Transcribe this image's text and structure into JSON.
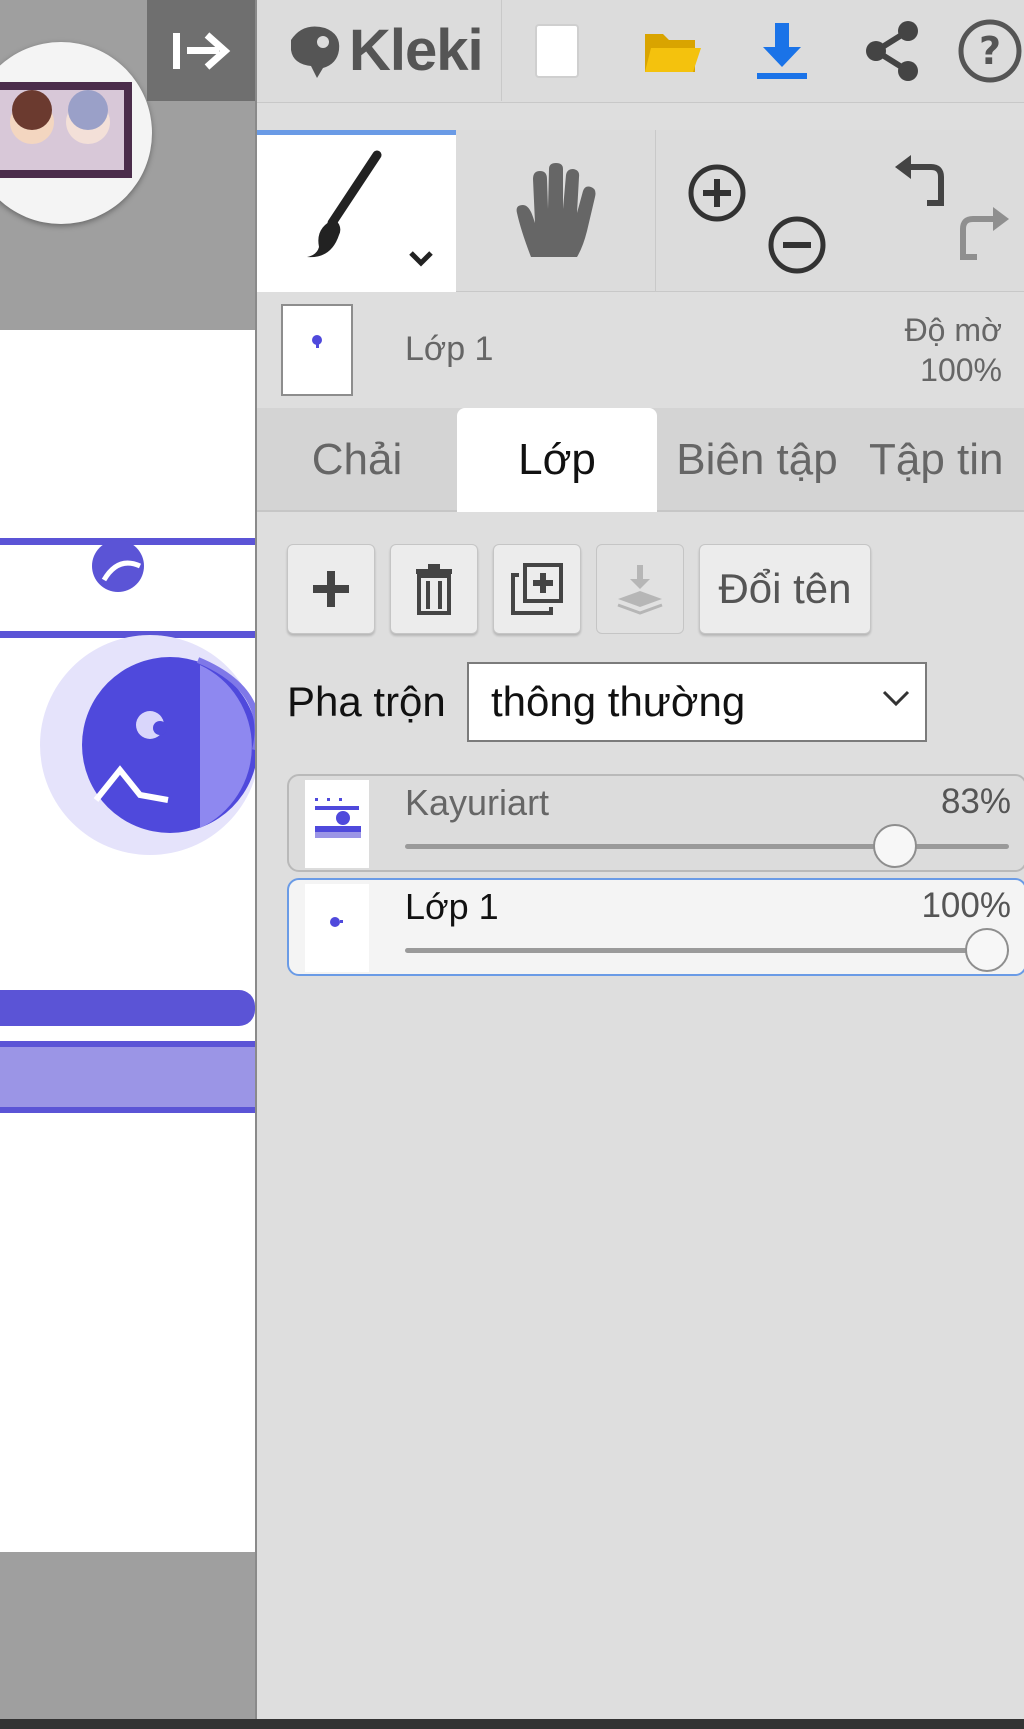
{
  "app": {
    "name": "Kleki"
  },
  "toolbar": {
    "logo_text": "Kleki",
    "buttons": [
      "new-document",
      "open-file",
      "download",
      "share",
      "help"
    ]
  },
  "tools": {
    "active": "brush",
    "zoom": [
      "zoom-in",
      "zoom-out"
    ],
    "history": [
      "undo",
      "redo"
    ]
  },
  "current_layer": {
    "name": "Lớp 1",
    "opacity_label": "Độ mờ",
    "opacity_value": "100%"
  },
  "tabs": [
    {
      "label": "Chải",
      "active": false
    },
    {
      "label": "Lớp",
      "active": true
    },
    {
      "label": "Biên tập",
      "active": false
    },
    {
      "label": "Tập tin",
      "active": false
    }
  ],
  "layer_actions": {
    "rename_label": "Đổi tên"
  },
  "blend": {
    "label": "Pha trộn",
    "value": "thông thường"
  },
  "layers": [
    {
      "name": "Kayuriart",
      "opacity_text": "83%",
      "opacity": 0.83,
      "selected": false
    },
    {
      "name": "Lớp 1",
      "opacity_text": "100%",
      "opacity": 1.0,
      "selected": true
    }
  ],
  "colors": {
    "accent": "#6a9be6",
    "download_blue": "#1a73e8",
    "folder_yellow": "#f4c20d",
    "canvas_purple": "#5b54d6",
    "canvas_light_purple": "#9b95e6"
  }
}
